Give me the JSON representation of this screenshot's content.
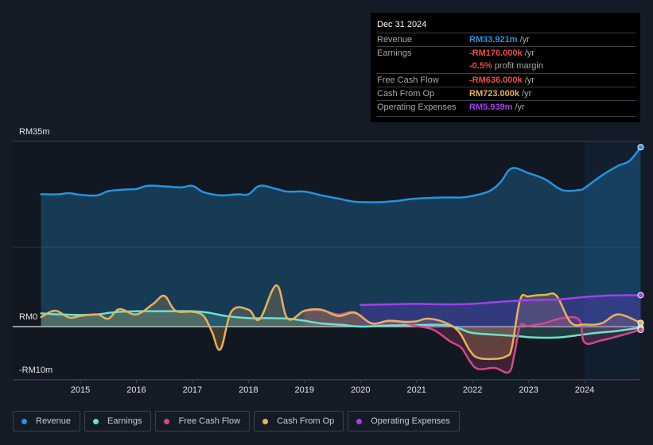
{
  "tooltip": {
    "date": "Dec 31 2024",
    "rows": [
      {
        "label": "Revenue",
        "value": "RM33.921m",
        "suffix": " /yr",
        "color": "#2394df"
      },
      {
        "label": "Earnings",
        "value": "-RM176.000k",
        "suffix": " /yr",
        "color": "#e84c4c"
      },
      {
        "label": "",
        "value": "-0.5%",
        "suffix": " profit margin",
        "color": "#e84c4c"
      },
      {
        "label": "Free Cash Flow",
        "value": "-RM636.000k",
        "suffix": " /yr",
        "color": "#e84c4c"
      },
      {
        "label": "Cash From Op",
        "value": "RM723.000k",
        "suffix": " /yr",
        "color": "#e8b15a"
      },
      {
        "label": "Operating Expenses",
        "value": "RM5.939m",
        "suffix": " /yr",
        "color": "#a23ff0"
      }
    ]
  },
  "legend": [
    {
      "label": "Revenue",
      "color": "#2394df"
    },
    {
      "label": "Earnings",
      "color": "#6ae2cf"
    },
    {
      "label": "Free Cash Flow",
      "color": "#d1498a"
    },
    {
      "label": "Cash From Op",
      "color": "#e8b15a"
    },
    {
      "label": "Operating Expenses",
      "color": "#a23ff0"
    }
  ],
  "chart_data": {
    "type": "area",
    "title": "",
    "xlabel": "",
    "ylabel": "",
    "currency_unit": "RM millions",
    "ylim": [
      -10,
      35
    ],
    "y_ticks": [
      {
        "value": 35,
        "label": "RM35m"
      },
      {
        "value": 0,
        "label": "RM0"
      },
      {
        "value": -10,
        "label": "-RM10m"
      }
    ],
    "x_ticks": [
      "2015",
      "2016",
      "2017",
      "2018",
      "2019",
      "2020",
      "2021",
      "2022",
      "2023",
      "2024"
    ],
    "xlim": [
      2014.3,
      2025.0
    ],
    "highlight_from": 2024.0,
    "grid": true,
    "legend_position": "bottom-left",
    "series": [
      {
        "name": "Revenue",
        "color": "#2394df",
        "x": [
          2014.3,
          2014.6,
          2014.8,
          2015.0,
          2015.3,
          2015.5,
          2015.8,
          2016.0,
          2016.2,
          2016.5,
          2016.8,
          2017.0,
          2017.2,
          2017.5,
          2017.8,
          2018.0,
          2018.2,
          2018.5,
          2018.7,
          2019.0,
          2019.3,
          2019.6,
          2019.9,
          2020.3,
          2020.6,
          2020.9,
          2021.2,
          2021.5,
          2021.8,
          2022.0,
          2022.3,
          2022.5,
          2022.7,
          2023.0,
          2023.3,
          2023.6,
          2023.9,
          2024.0,
          2024.3,
          2024.6,
          2024.8,
          2025.0
        ],
        "values": [
          25,
          25,
          25.2,
          24.9,
          24.8,
          25.6,
          25.9,
          26.0,
          26.6,
          26.5,
          26.3,
          26.6,
          25.4,
          24.8,
          25.0,
          25.0,
          26.6,
          26.0,
          25.5,
          25.5,
          24.8,
          24.2,
          23.6,
          23.5,
          23.7,
          24.1,
          24.3,
          24.4,
          24.4,
          24.7,
          25.6,
          27.3,
          29.9,
          29.0,
          27.8,
          25.8,
          25.8,
          26.2,
          28.5,
          30.4,
          31.3,
          33.9
        ]
      },
      {
        "name": "Earnings",
        "color": "#6ae2cf",
        "x": [
          2014.3,
          2014.6,
          2015.0,
          2015.3,
          2015.6,
          2016.0,
          2016.5,
          2017.0,
          2017.3,
          2017.6,
          2018.0,
          2018.3,
          2018.7,
          2019.0,
          2019.3,
          2019.7,
          2020.0,
          2020.5,
          2021.0,
          2021.5,
          2021.8,
          2022.0,
          2022.5,
          2022.8,
          2023.0,
          2023.3,
          2023.6,
          2023.9,
          2024.2,
          2024.6,
          2025.0
        ],
        "values": [
          2.5,
          2.3,
          2.2,
          2.3,
          2.7,
          2.9,
          2.9,
          2.9,
          2.6,
          2.0,
          1.6,
          1.6,
          1.5,
          1.1,
          0.6,
          0.3,
          0.0,
          0.2,
          0.3,
          0.3,
          -0.5,
          -1.2,
          -1.6,
          -1.8,
          -2.0,
          -2.1,
          -2.0,
          -1.6,
          -1.2,
          -0.8,
          -0.2
        ]
      },
      {
        "name": "Free Cash Flow",
        "color": "#d1498a",
        "x": [
          2019.0,
          2019.3,
          2019.6,
          2019.9,
          2020.2,
          2020.5,
          2020.8,
          2021.0,
          2021.3,
          2021.6,
          2021.8,
          2021.95,
          2022.1,
          2022.4,
          2022.65,
          2022.75,
          2022.85,
          2023.0,
          2023.3,
          2023.6,
          2023.9,
          2024.0,
          2024.3,
          2024.6,
          2025.0
        ],
        "values": [
          3.0,
          3.1,
          2.3,
          2.7,
          0.6,
          1.0,
          0.6,
          0.1,
          -0.6,
          -2.8,
          -4.0,
          -6.5,
          -8.0,
          -7.8,
          -8.6,
          -5.0,
          0.1,
          0.1,
          0.7,
          1.6,
          1.3,
          -3.0,
          -2.6,
          -1.8,
          -0.6
        ]
      },
      {
        "name": "Cash From Op",
        "color": "#e8b15a",
        "x": [
          2014.3,
          2014.55,
          2014.8,
          2015.0,
          2015.3,
          2015.5,
          2015.7,
          2016.0,
          2016.3,
          2016.5,
          2016.7,
          2017.0,
          2017.2,
          2017.35,
          2017.5,
          2017.7,
          2018.0,
          2018.2,
          2018.5,
          2018.7,
          2019.0,
          2019.3,
          2019.6,
          2019.9,
          2020.2,
          2020.5,
          2020.8,
          2021.0,
          2021.2,
          2021.5,
          2021.75,
          2021.95,
          2022.1,
          2022.4,
          2022.6,
          2022.7,
          2022.85,
          2023.0,
          2023.3,
          2023.5,
          2023.75,
          2024.0,
          2024.3,
          2024.6,
          2025.0
        ],
        "values": [
          1.8,
          3.0,
          1.7,
          2.0,
          2.3,
          1.5,
          3.3,
          2.3,
          4.3,
          5.8,
          3.0,
          2.8,
          2.0,
          -1.0,
          -4.3,
          2.9,
          3.2,
          1.4,
          7.8,
          1.5,
          3.0,
          3.2,
          2.0,
          2.6,
          0.6,
          1.1,
          0.9,
          1.0,
          1.5,
          0.8,
          -0.9,
          -4.5,
          -5.9,
          -6.1,
          -5.6,
          -4.0,
          5.1,
          5.7,
          6.0,
          5.8,
          0.8,
          0.4,
          0.6,
          2.3,
          0.7
        ]
      },
      {
        "name": "Operating Expenses",
        "color": "#a23ff0",
        "x": [
          2020.0,
          2020.5,
          2021.0,
          2021.5,
          2022.0,
          2022.5,
          2023.0,
          2023.5,
          2024.0,
          2024.5,
          2025.0
        ],
        "values": [
          4.1,
          4.2,
          4.3,
          4.2,
          4.3,
          4.7,
          5.0,
          5.1,
          5.6,
          5.9,
          5.939
        ]
      }
    ]
  }
}
